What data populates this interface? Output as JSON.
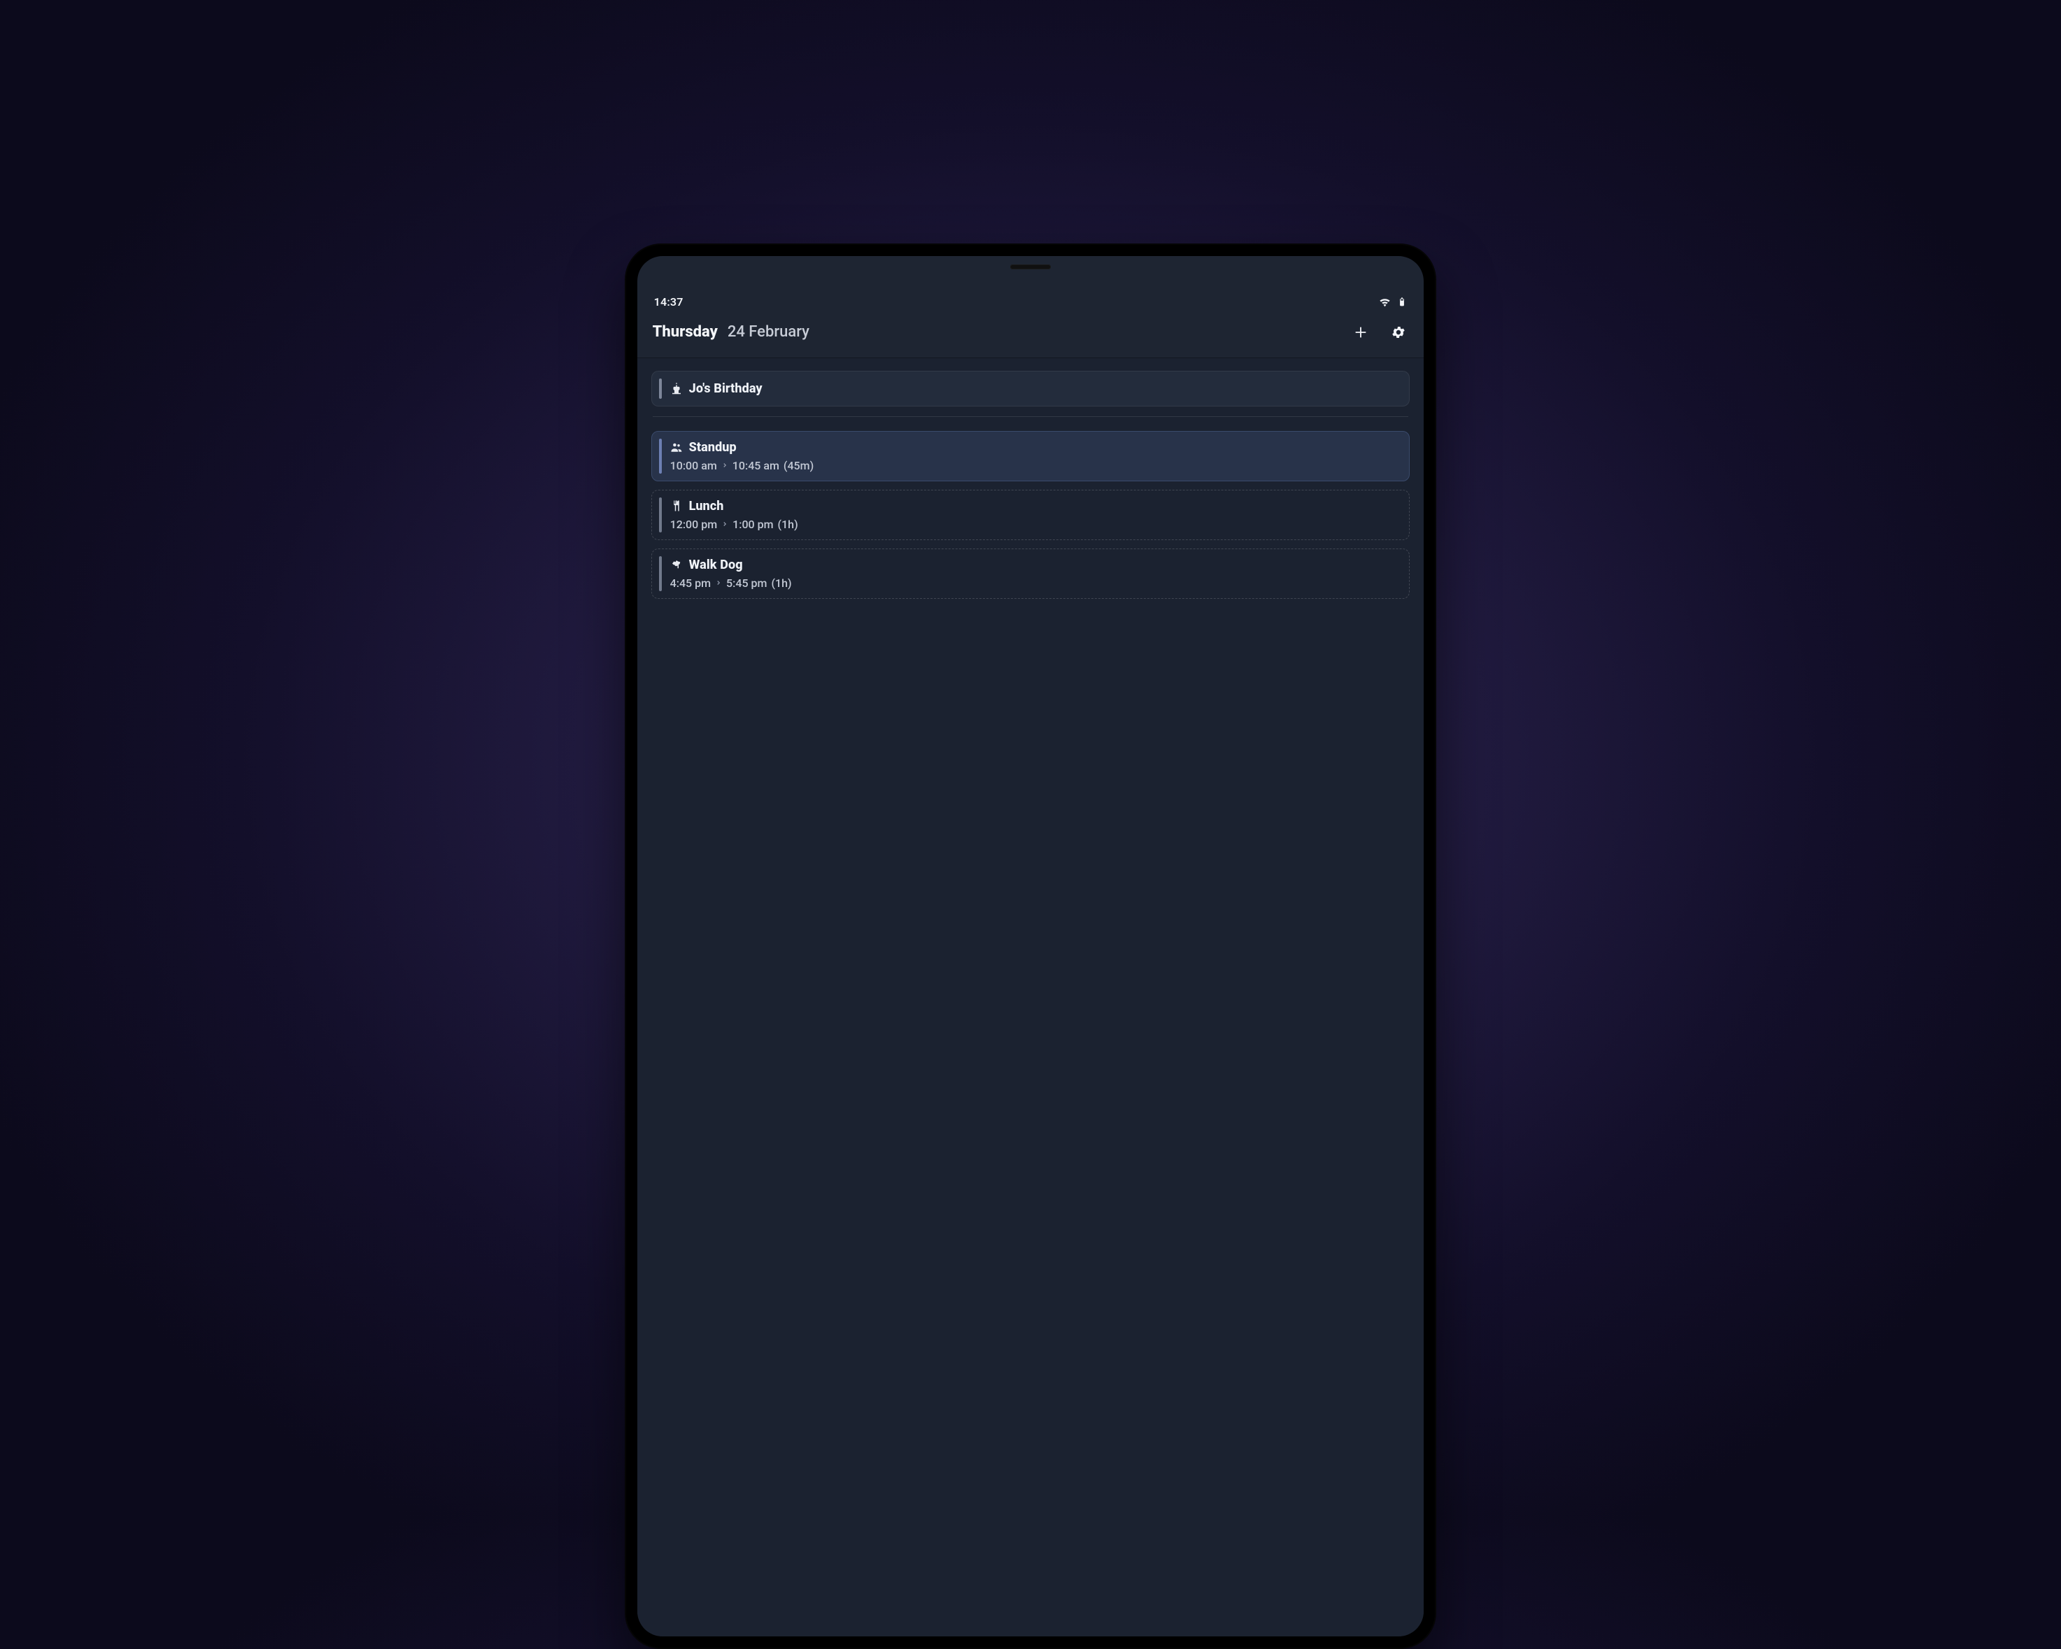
{
  "statusbar": {
    "time": "14:37"
  },
  "header": {
    "day": "Thursday",
    "date": "24 February",
    "icons": {
      "add": "plus-icon",
      "settings": "gear-icon",
      "wifi": "wifi-icon",
      "battery": "battery-icon"
    }
  },
  "colors": {
    "stripe_allday": "#7e879a",
    "stripe_current": "#6d7fb3",
    "stripe_upcoming": "#717a8c",
    "card_current_bg": "#28334a",
    "card_bg": "#232c3c",
    "screen_bg": "#1e2532",
    "content_bg": "#1b2230"
  },
  "events": {
    "allday": [
      {
        "icon": "birthday-cake-icon",
        "title": "Jo's Birthday"
      }
    ],
    "timed": [
      {
        "icon": "people-icon",
        "title": "Standup",
        "start": "10:00 am",
        "end": "10:45 am",
        "duration": "(45m)",
        "state": "current"
      },
      {
        "icon": "utensils-icon",
        "title": "Lunch",
        "start": "12:00 pm",
        "end": "1:00 pm",
        "duration": "(1h)",
        "state": "upcoming"
      },
      {
        "icon": "dog-icon",
        "title": "Walk Dog",
        "start": "4:45 pm",
        "end": "5:45 pm",
        "duration": "(1h)",
        "state": "upcoming"
      }
    ]
  }
}
